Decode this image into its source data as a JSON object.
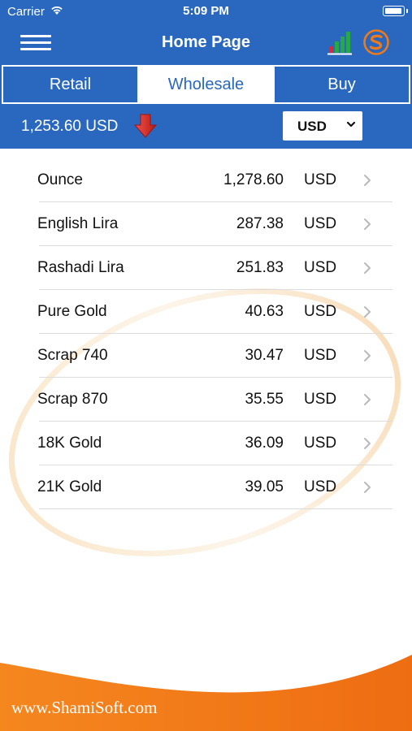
{
  "status_bar": {
    "carrier": "Carrier",
    "time": "5:09 PM"
  },
  "nav": {
    "title": "Home Page",
    "menu_icon": "hamburger-menu-icon",
    "chart_icon": "bar-chart-icon",
    "logo_icon": "shamisoft-logo-icon"
  },
  "tabs": [
    {
      "label": "Retail",
      "active": false
    },
    {
      "label": "Wholesale",
      "active": true
    },
    {
      "label": "Buy",
      "active": false
    }
  ],
  "rate": {
    "value": "1,253.60 USD",
    "trend_icon": "red-down-arrow-icon"
  },
  "currency_select": {
    "selected": "USD"
  },
  "items": [
    {
      "name": "Ounce",
      "value": "1,278.60",
      "currency": "USD"
    },
    {
      "name": "English Lira",
      "value": "287.38",
      "currency": "USD"
    },
    {
      "name": "Rashadi Lira",
      "value": "251.83",
      "currency": "USD"
    },
    {
      "name": "Pure Gold",
      "value": "40.63",
      "currency": "USD"
    },
    {
      "name": "Scrap 740",
      "value": "30.47",
      "currency": "USD"
    },
    {
      "name": "Scrap 870",
      "value": "35.55",
      "currency": "USD"
    },
    {
      "name": "18K Gold",
      "value": "36.09",
      "currency": "USD"
    },
    {
      "name": "21K Gold",
      "value": "39.05",
      "currency": "USD"
    }
  ],
  "footer": {
    "website": "www.ShamiSoft.com"
  },
  "colors": {
    "brand_blue": "#2a68bf",
    "orange": "#f07a1a",
    "trend_red": "#d8261c"
  }
}
